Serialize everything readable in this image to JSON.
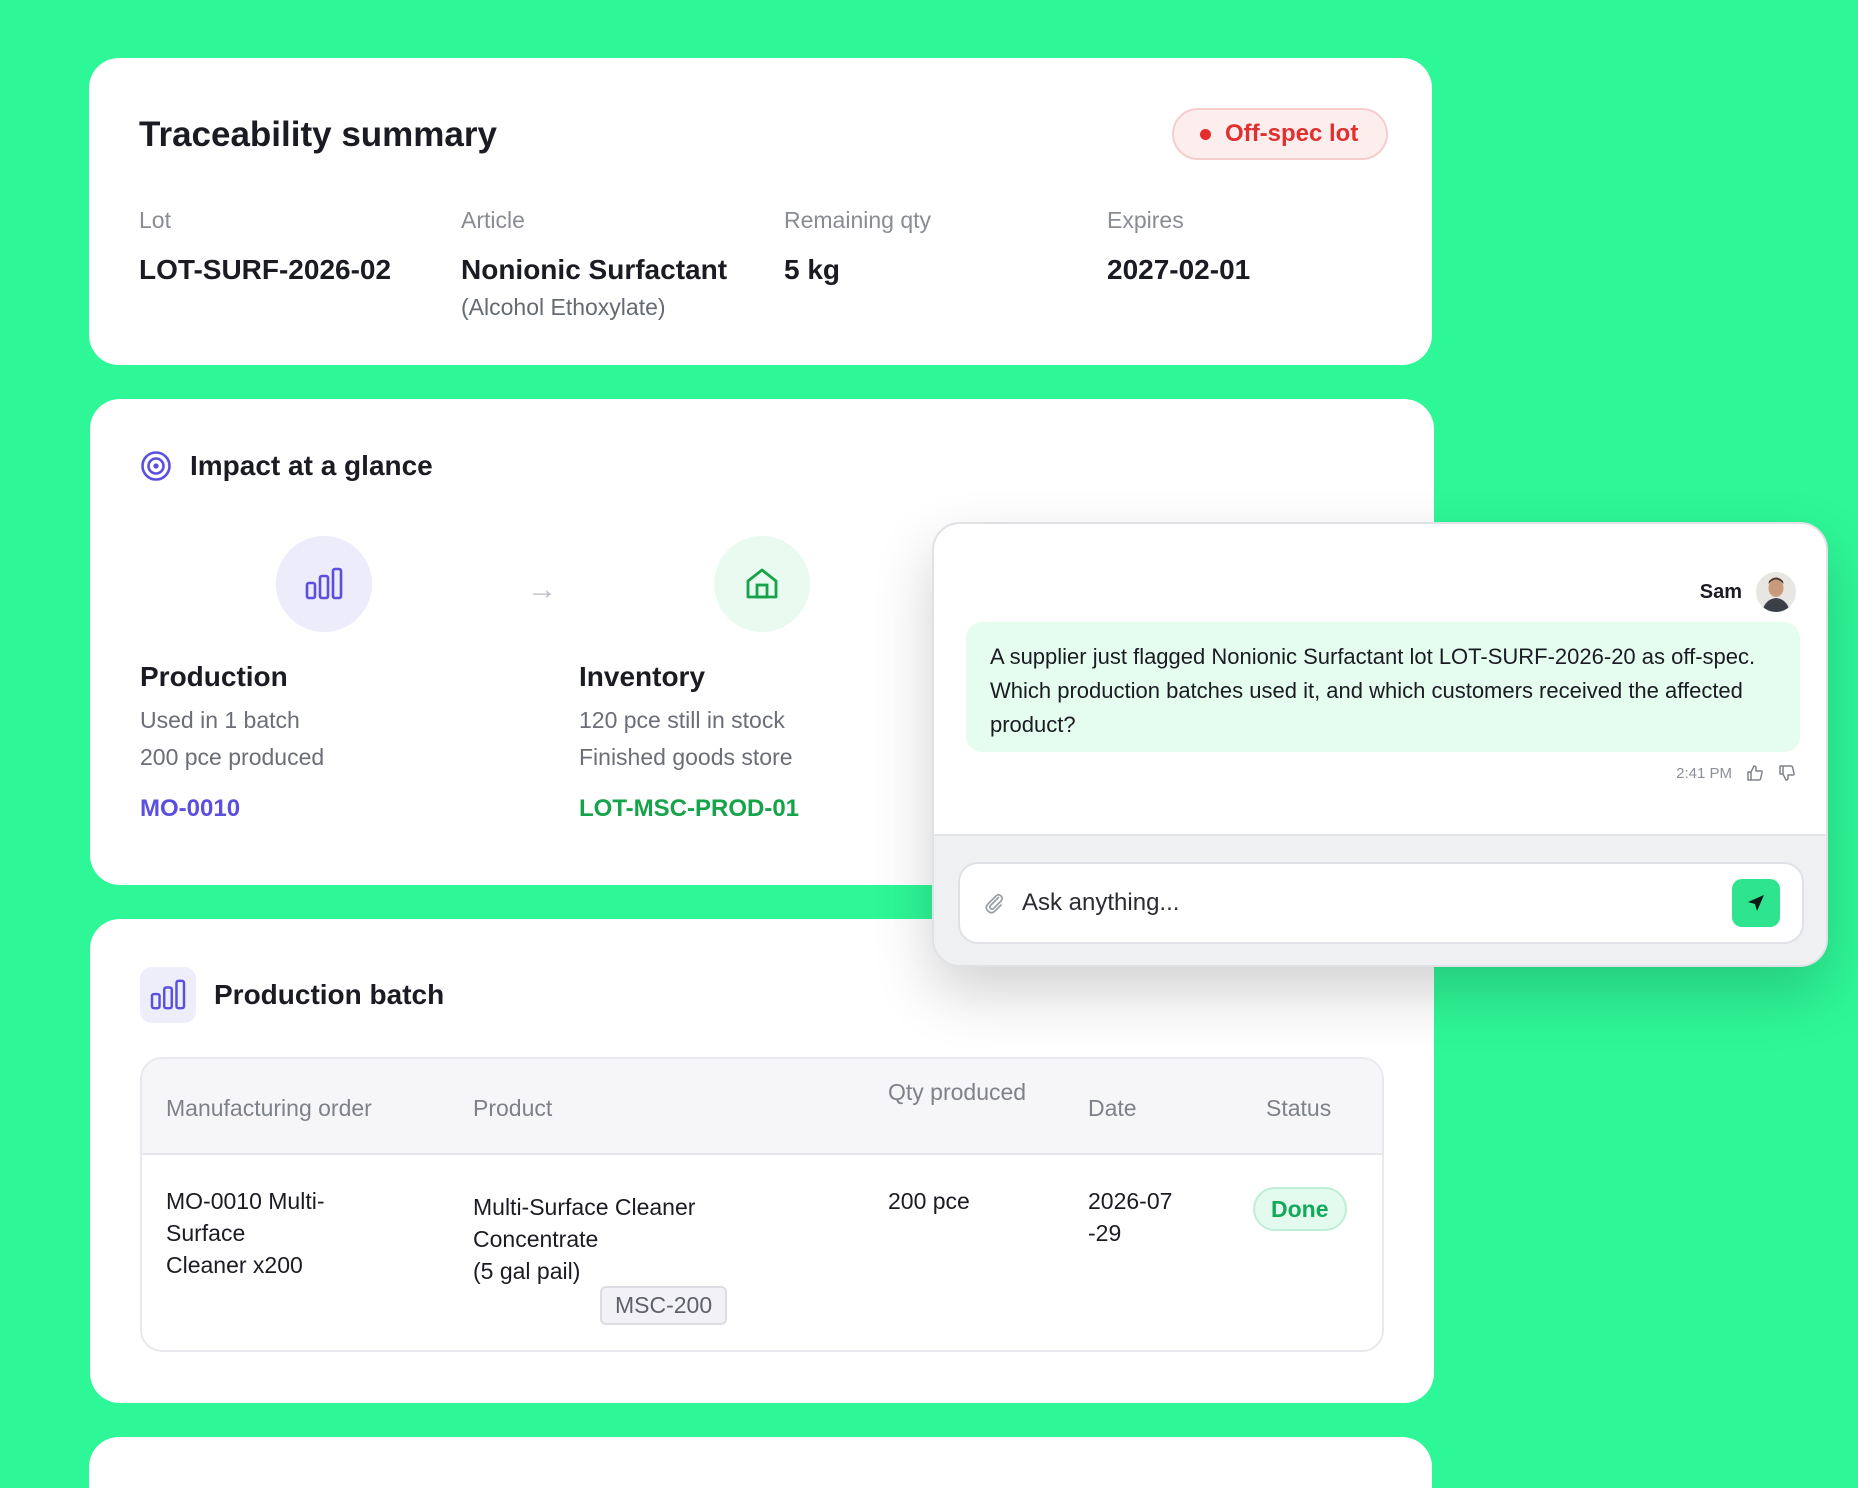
{
  "summary": {
    "title": "Traceability summary",
    "badge": "Off-spec lot",
    "fields": [
      {
        "label": "Lot",
        "value": "LOT-SURF-2026-02",
        "sub": ""
      },
      {
        "label": "Article",
        "value": "Nonionic Surfactant",
        "sub": "(Alcohol Ethoxylate)"
      },
      {
        "label": "Remaining qty",
        "value": "5 kg",
        "sub": ""
      },
      {
        "label": "Expires",
        "value": "2027-02-01",
        "sub": ""
      }
    ]
  },
  "impact": {
    "title": "Impact at a glance",
    "production": {
      "name": "Production",
      "line1": "Used in 1 batch",
      "line2": "200 pce produced",
      "link": "MO-0010"
    },
    "inventory": {
      "name": "Inventory",
      "line1": "120 pce still in stock",
      "line2": "Finished goods store",
      "link": "LOT-MSC-PROD-01"
    }
  },
  "batch": {
    "title": "Production batch",
    "columns": [
      "Manufacturing order",
      "Product",
      "Qty produced",
      "Date",
      "Status"
    ],
    "row": {
      "mo_line1": "MO-0010 Multi-",
      "mo_line2": "Surface",
      "mo_line3": "Cleaner x200",
      "product_line1": "Multi-Surface Cleaner",
      "product_line2": "Concentrate",
      "product_line3": "(5 gal pail)",
      "sku": "MSC-200",
      "qty": "200 pce",
      "date_line1": "2026-07",
      "date_line2": "-29",
      "status": "Done"
    }
  },
  "chat": {
    "user": "Sam",
    "message": "A supplier just flagged Nonionic Surfactant lot LOT-SURF-2026-20 as off-spec. Which production batches used it, and which customers received the affected product?",
    "time": "2:41 PM",
    "placeholder": "Ask anything..."
  },
  "colors": {
    "background": "#2ef797",
    "accent_purple": "#5b4fe0",
    "accent_green": "#16a34a",
    "danger": "#e03030"
  }
}
